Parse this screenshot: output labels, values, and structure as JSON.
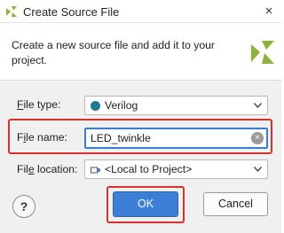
{
  "window": {
    "title": "Create Source File",
    "close_glyph": "×"
  },
  "header": {
    "description": "Create a new source file and add it to your project."
  },
  "form": {
    "file_type": {
      "label_prefix": "",
      "label_mnemonic": "F",
      "label_rest": "ile type:",
      "value": "Verilog"
    },
    "file_name": {
      "label_prefix": "F",
      "label_mnemonic": "i",
      "label_rest": "le name:",
      "value": "LED_twinkle",
      "clear_glyph": "×"
    },
    "file_location": {
      "label_prefix": "Fil",
      "label_mnemonic": "e",
      "label_rest": " location:",
      "value": "<Local to Project>"
    }
  },
  "buttons": {
    "help": "?",
    "ok": "OK",
    "cancel": "Cancel"
  },
  "colors": {
    "accent": "#3d7fd6",
    "highlight_box": "#d9302e",
    "logo_green": "#8cb43c",
    "verilog_icon": "#1f7a91"
  }
}
